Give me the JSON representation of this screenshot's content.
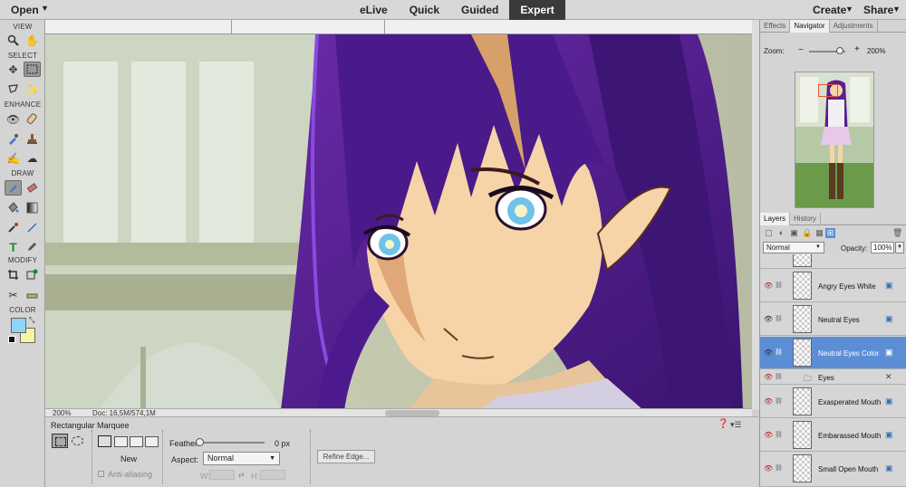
{
  "topbar": {
    "open_label": "Open",
    "modes": [
      "eLive",
      "Quick",
      "Guided",
      "Expert"
    ],
    "active_mode": "Expert",
    "create_label": "Create",
    "share_label": "Share"
  },
  "tools": {
    "sections": [
      "VIEW",
      "SELECT",
      "ENHANCE",
      "DRAW",
      "MODIFY",
      "COLOR"
    ],
    "foreground_color": "#8fd3f5",
    "background_color": "#f5f5a5"
  },
  "canvas": {
    "zoom": "200%",
    "doc": "Doc: 16,5M/574,1M"
  },
  "options": {
    "tool_name": "Rectangular Marquee",
    "new_label": "New",
    "anti_alias_label": "Anti-aliasing",
    "feather_label": "Feather:",
    "feather_value": "0 px",
    "aspect_label": "Aspect:",
    "aspect_value": "Normal",
    "w_label": "W:",
    "h_label": "H:",
    "refine_label": "Refine Edge..."
  },
  "navigator": {
    "tabs": [
      "Effects",
      "Navigator",
      "Adjustments"
    ],
    "active_tab": "Navigator",
    "zoom_label": "Zoom:",
    "zoom_value": "200%"
  },
  "layers_panel": {
    "tabs": [
      "Layers",
      "History"
    ],
    "blend_mode": "Normal",
    "opacity_label": "Opacity:",
    "opacity_value": "100%",
    "layers": [
      {
        "name": "Angry Eyes White",
        "visible": false,
        "selected": false
      },
      {
        "name": "Neutral Eyes",
        "visible": true,
        "selected": false
      },
      {
        "name": "Neutral Eyes Color",
        "visible": true,
        "selected": true
      },
      {
        "name": "Eyes",
        "visible": false,
        "selected": false,
        "group": true
      },
      {
        "name": "Exasperated Mouth",
        "visible": false,
        "selected": false
      },
      {
        "name": "Embarassed Mouth",
        "visible": false,
        "selected": false
      },
      {
        "name": "Small Open Mouth",
        "visible": false,
        "selected": false
      }
    ]
  }
}
